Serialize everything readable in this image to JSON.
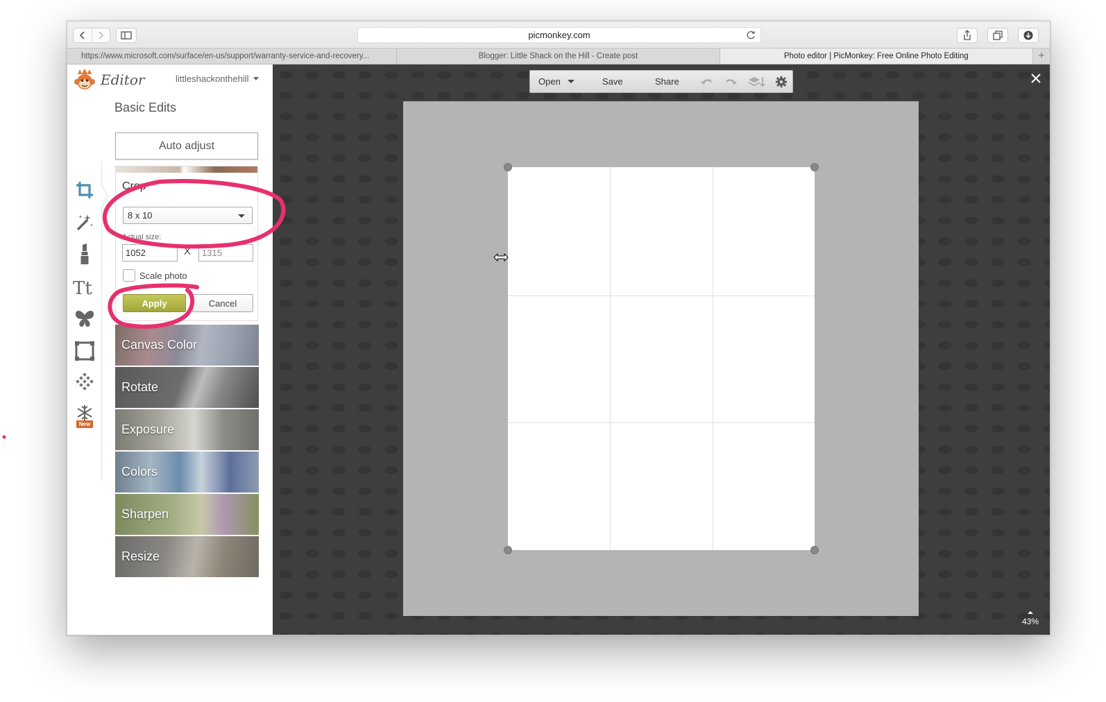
{
  "browser": {
    "url": "picmonkey.com",
    "tabs": [
      {
        "title": "https://www.microsoft.com/surface/en-us/support/warranty-service-and-recovery..."
      },
      {
        "title": "Blogger: Little Shack on the Hill - Create post"
      },
      {
        "title": "Photo editor | PicMonkey: Free Online Photo Editing"
      }
    ],
    "new_tab": "+"
  },
  "app": {
    "title": "Editor",
    "username": "littleshackonthehill",
    "section_title": "Basic Edits",
    "auto_adjust_label": "Auto adjust",
    "crop": {
      "title": "Crop",
      "ratio": "8 x 10",
      "size_label": "Actual size:",
      "width": "1052",
      "times": "X",
      "height": "1315",
      "scale_label": "Scale photo",
      "scale_checked": false,
      "apply_label": "Apply",
      "cancel_label": "Cancel"
    },
    "features": [
      {
        "label": "Canvas Color"
      },
      {
        "label": "Rotate"
      },
      {
        "label": "Exposure"
      },
      {
        "label": "Colors"
      },
      {
        "label": "Sharpen"
      },
      {
        "label": "Resize"
      }
    ],
    "tools": [
      "crop-icon",
      "magic-wand-icon",
      "lipstick-icon",
      "text-icon",
      "butterfly-icon",
      "frame-icon",
      "texture-icon",
      "snowflake-icon"
    ],
    "new_badge": "New",
    "editor_toolbar": {
      "open_label": "Open",
      "save_label": "Save",
      "share_label": "Share"
    },
    "zoom": "43%"
  },
  "colors": {
    "accent_olive": "#a7ac3f",
    "annotation_pink": "#e8306f",
    "workspace_bg": "#3e3e3e",
    "crop_icon_blue": "#4b8fb0"
  }
}
